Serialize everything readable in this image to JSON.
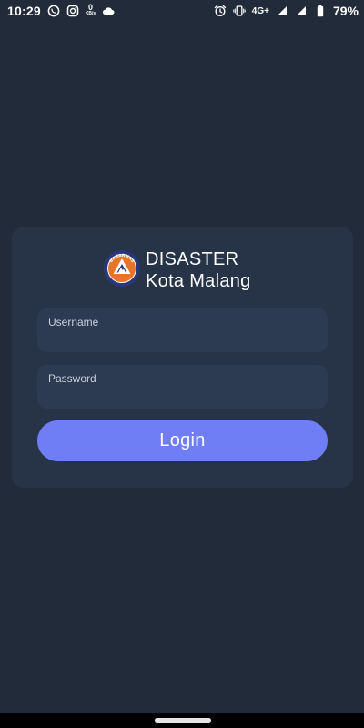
{
  "status_bar": {
    "time": "10:29",
    "net_speed_value": "0",
    "net_speed_unit": "KB/s",
    "network_type": "4G+",
    "battery_percent": "79%",
    "icons": [
      "whatsapp-icon",
      "instagram-icon",
      "cloud-icon",
      "alarm-icon",
      "vibrate-icon",
      "signal-icon",
      "battery-icon"
    ]
  },
  "brand": {
    "line1": "DISASTER",
    "line2": "Kota Malang",
    "logo_text": "BASARNAS"
  },
  "login": {
    "username_label": "Username",
    "username_value": "",
    "password_label": "Password",
    "password_value": "",
    "button_label": "Login"
  },
  "colors": {
    "background": "#222b39",
    "card": "#273448",
    "field": "#2c3a52",
    "button": "#6f7ef5"
  }
}
